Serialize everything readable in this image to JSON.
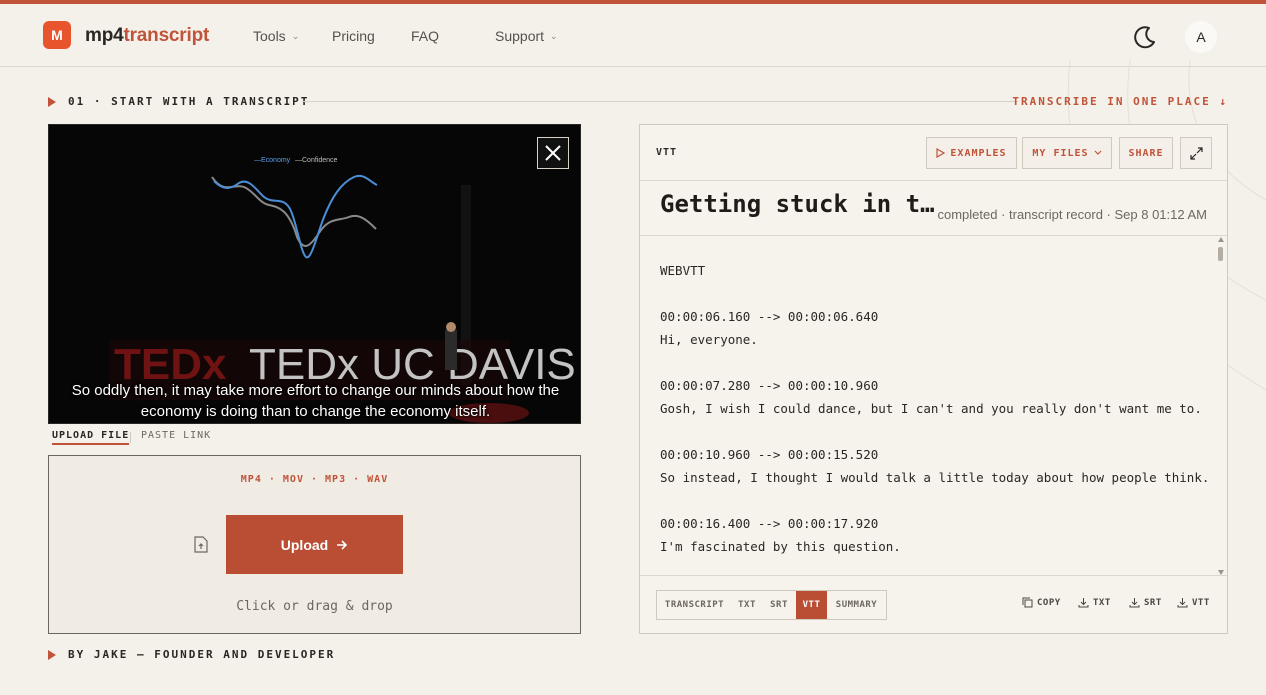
{
  "brand": {
    "badge": "M",
    "name_part1": "mp4",
    "name_part2": "transcript"
  },
  "nav": {
    "tools": "Tools",
    "pricing": "Pricing",
    "faq": "FAQ",
    "support": "Support",
    "avatar_initial": "A"
  },
  "section1": {
    "title": "01 · START WITH A TRANSCRIPT",
    "right_link": "TRANSCRIBE IN ONE PLACE ↓"
  },
  "video": {
    "caption_line1": "So oddly then, it may take more effort to change our minds about how the",
    "caption_line2": "economy is doing than to change the economy itself.",
    "legend_economy": "—Economy",
    "legend_confidence": "—Confidence",
    "stage_logo": "TEDx UC DAVIS"
  },
  "upload_tabs": {
    "upload_file": "UPLOAD FILE",
    "paste_link": "PASTE LINK"
  },
  "dropzone": {
    "formats": "MP4 · MOV · MP3 · WAV",
    "upload_label": "Upload",
    "hint": "Click or drag & drop"
  },
  "byline": "BY JAKE — FOUNDER AND DEVELOPER",
  "panel": {
    "format_label": "VTT",
    "examples": "EXAMPLES",
    "my_files": "MY FILES",
    "share": "SHARE",
    "title": "Getting stuck in t…",
    "meta": "completed · transcript record · Sep 8 01:12 AM",
    "header_line": "WEBVTT",
    "cues": [
      {
        "time": "00:00:06.160 --> 00:00:06.640",
        "text": "Hi, everyone."
      },
      {
        "time": "00:00:07.280 --> 00:00:10.960",
        "text": "Gosh, I wish I could dance, but I can't and you really don't want me to."
      },
      {
        "time": "00:00:10.960 --> 00:00:15.520",
        "text": "So instead, I thought I would talk a little today about how people think."
      },
      {
        "time": "00:00:16.400 --> 00:00:17.920",
        "text": "I'm fascinated by this question."
      }
    ],
    "view_tabs": [
      "TRANSCRIPT",
      "TXT",
      "SRT",
      "VTT",
      "SUMMARY"
    ],
    "active_view": "VTT",
    "actions": {
      "copy": "COPY",
      "txt": "TXT",
      "srt": "SRT",
      "vtt": "VTT"
    }
  },
  "colors": {
    "accent": "#c0533a",
    "button": "#b94e34",
    "background": "#f4f1ea",
    "logo_badge": "#e8552d"
  }
}
